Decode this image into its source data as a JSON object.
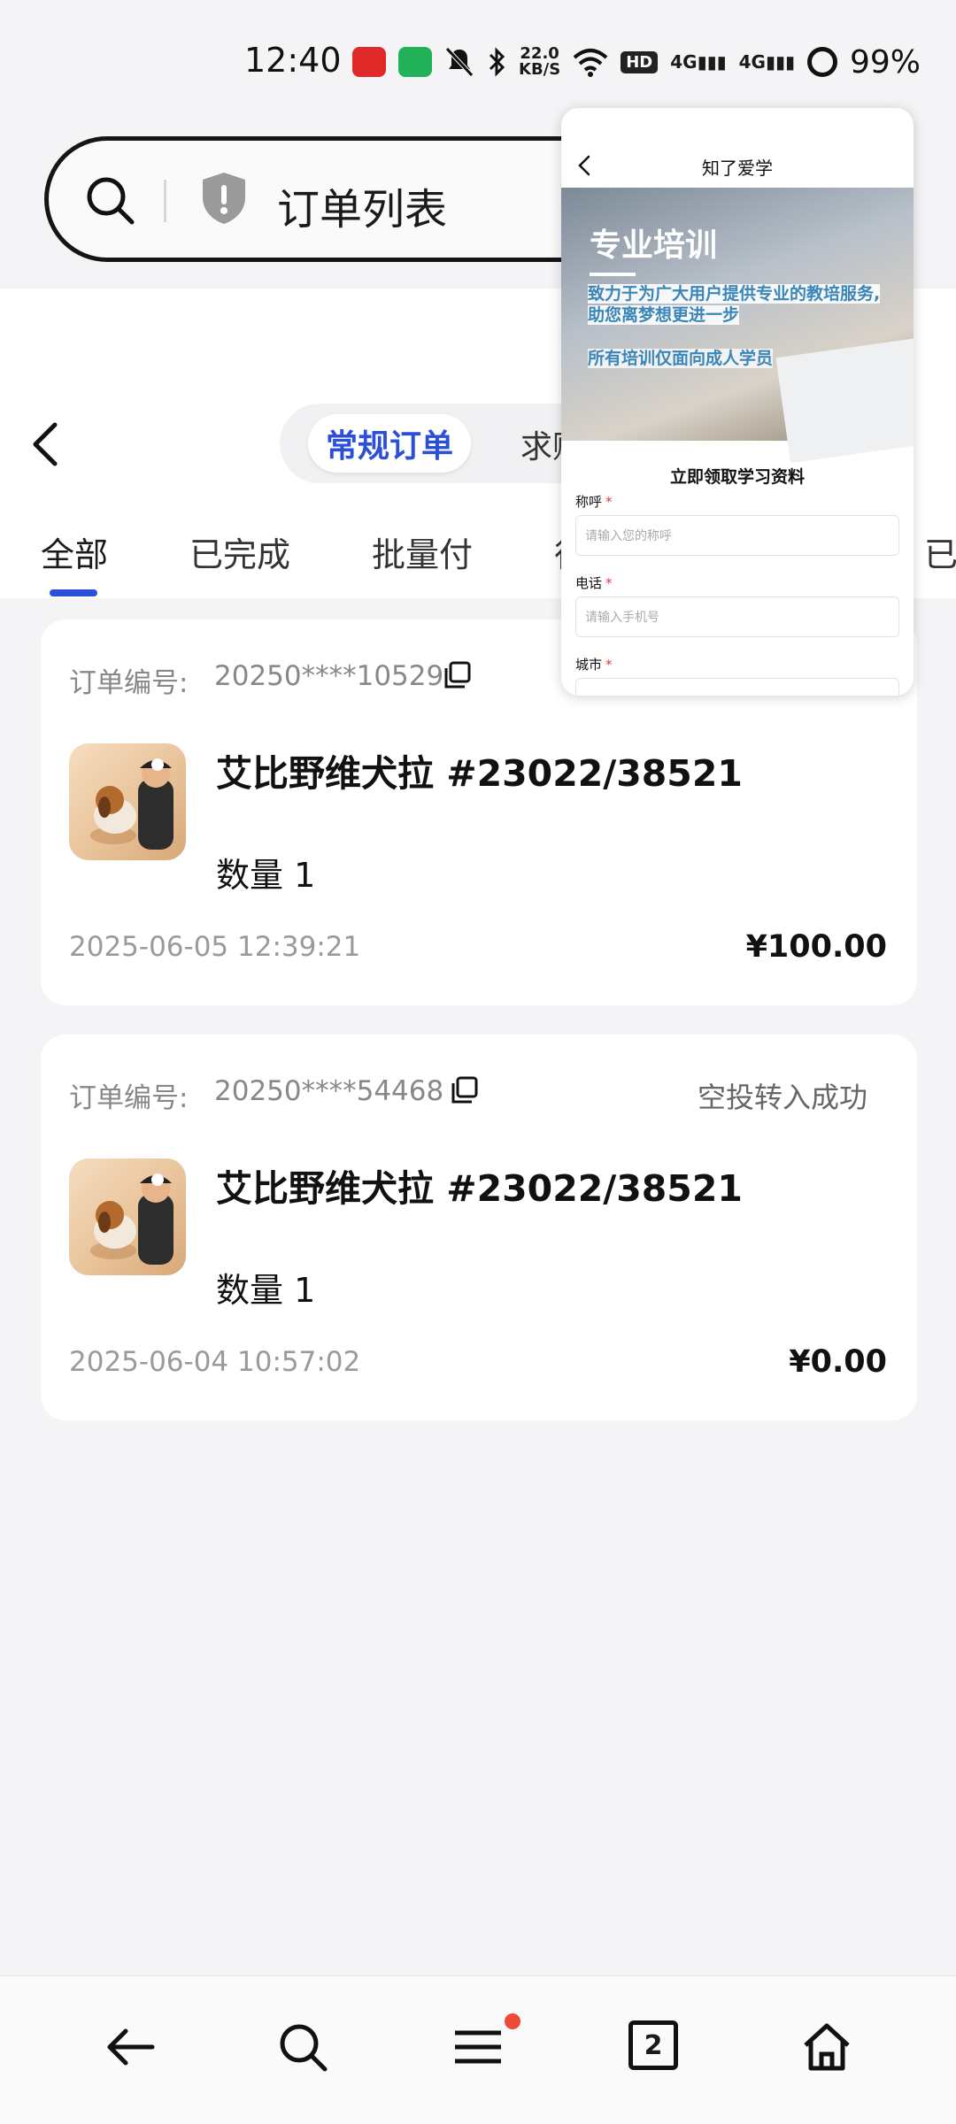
{
  "status_bar": {
    "time": "12:40",
    "net_speed_value": "22.0",
    "net_speed_unit": "KB/S",
    "hd_label": "HD",
    "signal1": "4G",
    "signal2": "4G",
    "battery": "99%"
  },
  "address_bar": {
    "page_title": "订单列表"
  },
  "header": {
    "segments": [
      "常规订单",
      "求购"
    ],
    "tabs": [
      "全部",
      "已完成",
      "批量付",
      "待",
      "已"
    ]
  },
  "orders": [
    {
      "order_no_label": "订单编号:",
      "order_no": "20250****10529",
      "status": "",
      "title": "艾比野维犬拉 #23022/38521",
      "quantity": "数量 1",
      "date": "2025-06-05 12:39:21",
      "price": "¥100.00"
    },
    {
      "order_no_label": "订单编号:",
      "order_no": "20250****54468",
      "status": "空投转入成功",
      "title": "艾比野维犬拉 #23022/38521",
      "quantity": "数量 1",
      "date": "2025-06-04 10:57:02",
      "price": "¥0.00"
    }
  ],
  "popup": {
    "title": "知了爱学",
    "banner_heading": "专业培训",
    "banner_line1": "致力于为广大用户提供专业的教培服务,",
    "banner_line2": "助您离梦想更进一步",
    "banner_line3": "所有培训仅面向成人学员",
    "form_title": "立即领取学习资料",
    "fields": [
      {
        "label": "称呼",
        "placeholder": "请输入您的称呼"
      },
      {
        "label": "电话",
        "placeholder": "请输入手机号"
      },
      {
        "label": "城市",
        "placeholder": ""
      }
    ]
  },
  "bottom_nav": {
    "tab_count": "2"
  },
  "colors": {
    "accent": "#2b4fd8",
    "badge_dot": "#ee4a3a",
    "banner_text": "#3b86b8"
  }
}
